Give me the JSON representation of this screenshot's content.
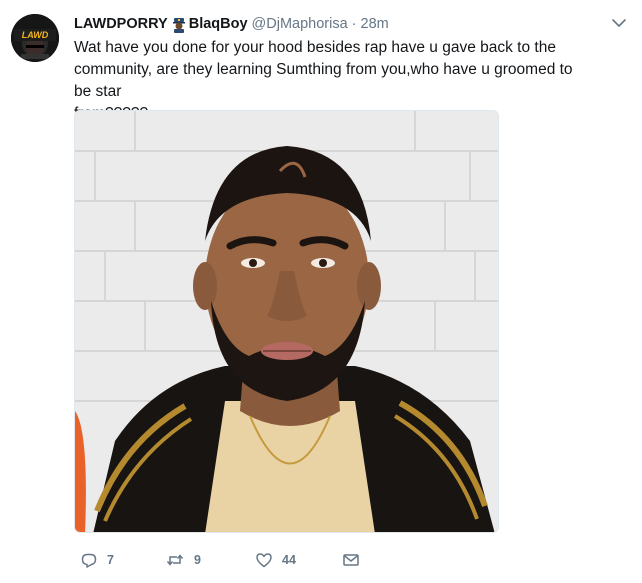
{
  "tweet": {
    "display_name": "LAWDPORRY",
    "display_name_suffix": "BlaqBoy",
    "handle": "@DjMaphorisa",
    "separator": "·",
    "time": "28m",
    "text": "Wat have you done for your hood besides rap have u gave back to the\ncommunity, are they learning Sumthing from you,who have u groomed to be star\nfrom?????",
    "avatar_badge_text": "LAWDPORRY"
  },
  "actions": {
    "reply_count": "7",
    "retweet_count": "9",
    "like_count": "44"
  },
  "icons": {
    "caret": "chevron-down-icon",
    "reply": "reply-icon",
    "retweet": "retweet-icon",
    "like": "heart-icon",
    "dm": "envelope-icon",
    "emoji": "police-officer-emoji"
  },
  "colors": {
    "name": "#14171a",
    "secondary": "#657786",
    "icon": "#657786",
    "avatar_text": "#f2b51e"
  }
}
